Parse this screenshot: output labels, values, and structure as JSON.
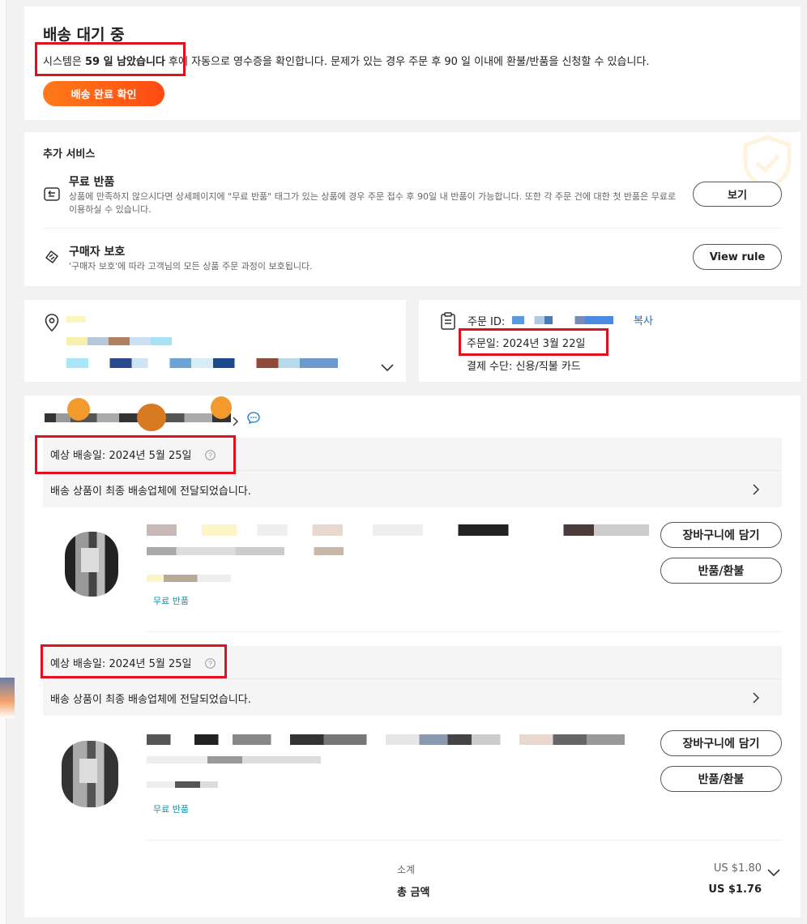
{
  "status": {
    "title": "배송 대기 중",
    "notice_prefix": "시스템은 ",
    "notice_bold": "59 일 남았습니다",
    "notice_suffix": " 후에 자동으로 영수증을 확인합니다. 문제가 있는 경우 주문 후 90 일 이내에 환불/반품을 신청할 수 있습니다.",
    "confirm_button": "배송 완료 확인"
  },
  "services": {
    "heading": "추가 서비스",
    "free_return": {
      "title": "무료 반품",
      "desc": "상품에 만족하지 않으시다면 상세페이지에 \"무료 반품\" 태그가 있는 상품에 경우 주문 접수 후 90일 내 반품이 가능합니다. 또한 각 주문 건에 대한 첫 반품은 무료로 이용하실 수 있습니다.",
      "button": "보기"
    },
    "buyer_protection": {
      "title": "구매자 보호",
      "desc": "'구매자 보호'에 따라 고객님의 모든 상품 주문 과정이 보호됩니다.",
      "button": "View rule"
    }
  },
  "order": {
    "id_label": "주문 ID:",
    "copy": "복사",
    "date": "주문일: 2024년 3월 22일",
    "payment": "결제 수단: 신용/직불 카드"
  },
  "packages": [
    {
      "delivery_date": "예상 배송일: 2024년 5월 25일",
      "status_text": "배송 상품이 최종 배송업체에 전달되었습니다.",
      "free_return_tag": "무료 반품",
      "cart_button": "장바구니에 담기",
      "return_button": "반품/환불"
    },
    {
      "delivery_date": "예상 배송일: 2024년 5월 25일",
      "status_text": "배송 상품이 최종 배송업체에 전달되었습니다.",
      "free_return_tag": "무료 반품",
      "cart_button": "장바구니에 담기",
      "return_button": "반품/환불"
    }
  ],
  "summary": {
    "subtotal_label": "소계",
    "subtotal_value": "US $1.80",
    "total_label": "총 금액",
    "total_value": "US $1.76"
  },
  "colors": {
    "accent": "#ff5a12",
    "highlight_box": "#e0101e",
    "link": "#1a73c9"
  },
  "icons": [
    "return-icon",
    "shield-hand-icon",
    "location-pin-icon",
    "clipboard-icon",
    "chevron-down-icon",
    "chevron-right-icon",
    "chat-icon",
    "help-circle-icon",
    "shield-check-icon"
  ]
}
